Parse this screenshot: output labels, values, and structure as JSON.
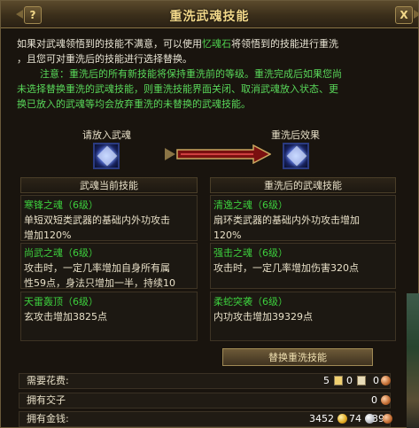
{
  "window": {
    "title": "重洗武魂技能",
    "help_label": "?",
    "close_label": "X"
  },
  "description": {
    "line1_a": "如果对武魂领悟到的技能不满意，可以使用",
    "line1_item": "忆魂石",
    "line1_b": "将领悟到的技能进行重洗",
    "line2": "，且您可对重洗后的技能进行选择替换。",
    "note1": "注意：重洗后的所有新技能将保持重洗前的等级。重洗完成后如果您尚",
    "note2": "未选择替换重洗的武魂技能，则重洗技能界面关闭、取消武魂放入状态、更",
    "note3": "换已放入的武魂等均会放弃重洗的未替换的武魂技能。"
  },
  "slots": {
    "left_label": "请放入武魂",
    "right_label": "重洗后效果",
    "left_icon": "weapon-soul-icon",
    "right_icon": "weapon-soul-icon"
  },
  "panels": {
    "current_header": "武魂当前技能",
    "after_header": "重洗后的武魂技能",
    "current": [
      {
        "name": "寒锋之魂（6级）",
        "lines": [
          "单短双短类武器的基础内外功攻击",
          "增加120%"
        ]
      },
      {
        "name": "尚武之魂（6级）",
        "lines": [
          "攻击时，一定几率增加自身所有属",
          "性59点，身法只增加一半，持续10"
        ]
      },
      {
        "name": "天雷轰顶（6级）",
        "lines": [
          "玄攻击增加3825点"
        ]
      }
    ],
    "after": [
      {
        "name": "清逸之魂（6级）",
        "lines": [
          "扇环类武器的基础内外功攻击增加",
          "120%"
        ]
      },
      {
        "name": "强击之魂（6级）",
        "lines": [
          "攻击时，一定几率增加伤害320点"
        ]
      },
      {
        "name": "柔蛇突袭（6级）",
        "lines": [
          "内功攻击增加39329点"
        ]
      }
    ]
  },
  "replace_button": "替换重洗技能",
  "costs": {
    "required": {
      "label": "需要花费:",
      "a": "5",
      "b": "0",
      "c": "0"
    },
    "owned_notes": {
      "label": "拥有交子",
      "value": "0"
    },
    "owned_money": {
      "label": "拥有金钱:",
      "gold": "3452",
      "silver": "74",
      "copper": "39"
    }
  },
  "colors": {
    "skill_name": "#3dcf3d",
    "title": "#f3d98a",
    "highlight": "#4fd24f"
  }
}
